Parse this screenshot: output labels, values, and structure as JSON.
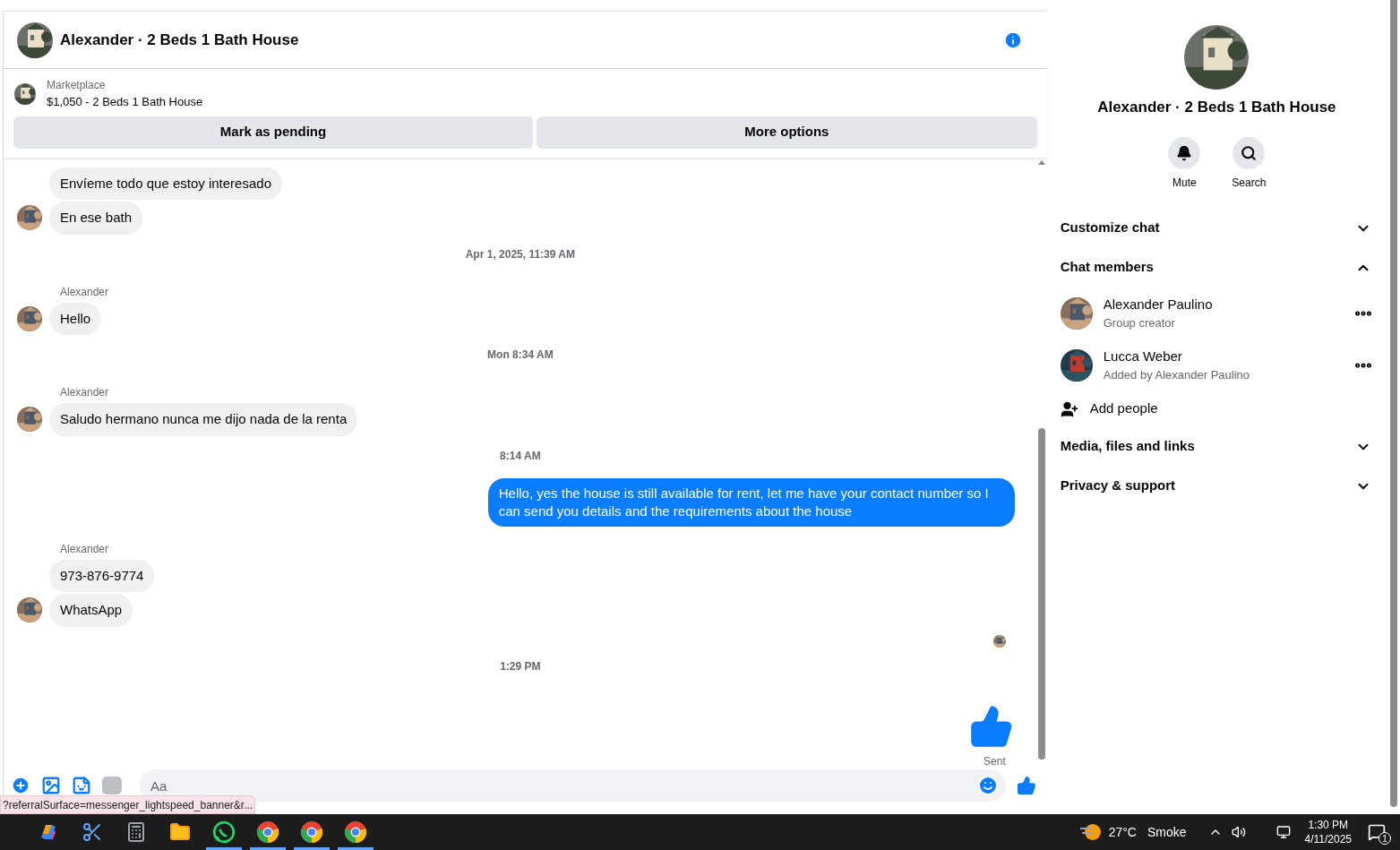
{
  "header": {
    "title": "Alexander · 2 Beds 1 Bath House"
  },
  "listing": {
    "source": "Marketplace",
    "title": "$1,050 - 2 Beds 1 Bath House",
    "actions": [
      "Mark as pending",
      "More options"
    ]
  },
  "messages": [
    {
      "kind": "incoming",
      "text": "Envíeme todo que estoy interesado",
      "avatar": false
    },
    {
      "kind": "incoming",
      "text": "En ese bath",
      "avatar": true
    },
    {
      "kind": "timestamp",
      "text": "Apr 1, 2025, 11:39 AM"
    },
    {
      "kind": "sender",
      "text": "Alexander"
    },
    {
      "kind": "incoming",
      "text": "Hello",
      "avatar": true
    },
    {
      "kind": "timestamp",
      "text": "Mon 8:34 AM"
    },
    {
      "kind": "sender",
      "text": "Alexander"
    },
    {
      "kind": "incoming",
      "text": "Saludo hermano nunca me dijo nada de la renta",
      "avatar": true
    },
    {
      "kind": "timestamp",
      "text": "8:14 AM"
    },
    {
      "kind": "outgoing",
      "text": "Hello, yes the house is still available for rent, let me have your contact number so I can send you details and the requirements about the house"
    },
    {
      "kind": "sender",
      "text": "Alexander"
    },
    {
      "kind": "incoming",
      "text": "973-876-9774",
      "avatar": false
    },
    {
      "kind": "incoming",
      "text": "WhatsApp",
      "avatar": true
    },
    {
      "kind": "seen"
    },
    {
      "kind": "timestamp",
      "text": "1:29 PM"
    },
    {
      "kind": "like"
    },
    {
      "kind": "status",
      "text": "Sent"
    }
  ],
  "composer": {
    "placeholder": "Aa"
  },
  "status_url": "?referralSurface=messenger_lightspeed_banner&r...",
  "details": {
    "title": "Alexander · 2 Beds 1 Bath House",
    "actions": [
      {
        "kind": "mute",
        "label": "Mute"
      },
      {
        "kind": "search",
        "label": "Search"
      }
    ],
    "sections": [
      {
        "label": "Customize chat",
        "expanded": false
      },
      {
        "label": "Chat members",
        "expanded": true,
        "members": [
          {
            "name": "Alexander Paulino",
            "role": "Group creator"
          },
          {
            "name": "Lucca Weber",
            "role": "Added by Alexander Paulino"
          }
        ],
        "add_label": "Add people"
      },
      {
        "label": "Media, files and links",
        "expanded": false
      },
      {
        "label": "Privacy & support",
        "expanded": false
      }
    ]
  },
  "taskbar": {
    "apps": [
      {
        "kind": "copilot",
        "running": false
      },
      {
        "kind": "snipping",
        "running": false
      },
      {
        "kind": "calculator",
        "running": false
      },
      {
        "kind": "files",
        "running": false
      },
      {
        "kind": "whatsapp",
        "running": true
      },
      {
        "kind": "chrome",
        "running": true
      },
      {
        "kind": "chrome",
        "running": true
      },
      {
        "kind": "chrome",
        "running": true
      }
    ],
    "weather": "27°C",
    "condition": "Smoke",
    "time": "1:30 PM",
    "date": "4/11/2025",
    "notifications": "1"
  }
}
